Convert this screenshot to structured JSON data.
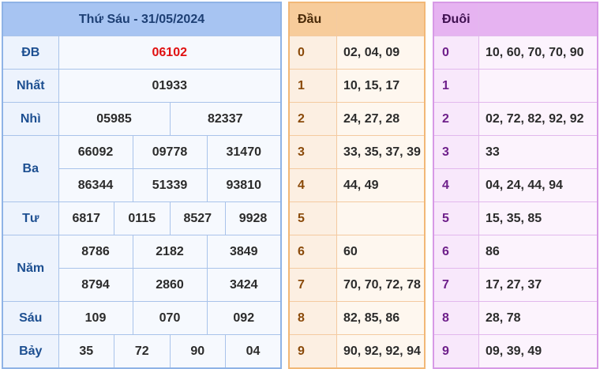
{
  "main": {
    "title": "Thứ Sáu - 31/05/2024",
    "rows": {
      "db": {
        "label": "ĐB",
        "values": [
          "06102"
        ]
      },
      "nhat": {
        "label": "Nhất",
        "values": [
          "01933"
        ]
      },
      "nhi": {
        "label": "Nhì",
        "values": [
          "05985",
          "82337"
        ]
      },
      "ba": {
        "label": "Ba",
        "values": [
          "66092",
          "09778",
          "31470",
          "86344",
          "51339",
          "93810"
        ]
      },
      "tu": {
        "label": "Tư",
        "values": [
          "6817",
          "0115",
          "8527",
          "9928"
        ]
      },
      "nam": {
        "label": "Năm",
        "values": [
          "8786",
          "2182",
          "3849",
          "8794",
          "2860",
          "3424"
        ]
      },
      "sau": {
        "label": "Sáu",
        "values": [
          "109",
          "070",
          "092"
        ]
      },
      "bay": {
        "label": "Bảy",
        "values": [
          "35",
          "72",
          "90",
          "04"
        ]
      }
    },
    "colors": {
      "special_prize": "#e01010",
      "header_bg": "#a7c4f2"
    }
  },
  "dau": {
    "header": "Đầu",
    "rows": [
      {
        "idx": "0",
        "vals": "02, 04, 09"
      },
      {
        "idx": "1",
        "vals": "10, 15, 17"
      },
      {
        "idx": "2",
        "vals": "24, 27, 28"
      },
      {
        "idx": "3",
        "vals": "33, 35, 37, 39"
      },
      {
        "idx": "4",
        "vals": "44, 49"
      },
      {
        "idx": "5",
        "vals": ""
      },
      {
        "idx": "6",
        "vals": "60"
      },
      {
        "idx": "7",
        "vals": "70, 70, 72, 78"
      },
      {
        "idx": "8",
        "vals": "82, 85, 86"
      },
      {
        "idx": "9",
        "vals": "90, 92, 92, 94"
      }
    ]
  },
  "duoi": {
    "header": "Đuôi",
    "rows": [
      {
        "idx": "0",
        "vals": "10, 60, 70, 70, 90"
      },
      {
        "idx": "1",
        "vals": ""
      },
      {
        "idx": "2",
        "vals": "02, 72, 82, 92, 92"
      },
      {
        "idx": "3",
        "vals": "33"
      },
      {
        "idx": "4",
        "vals": "04, 24, 44, 94"
      },
      {
        "idx": "5",
        "vals": "15, 35, 85"
      },
      {
        "idx": "6",
        "vals": "86"
      },
      {
        "idx": "7",
        "vals": "17, 27, 37"
      },
      {
        "idx": "8",
        "vals": "28, 78"
      },
      {
        "idx": "9",
        "vals": "09, 39, 49"
      }
    ]
  }
}
